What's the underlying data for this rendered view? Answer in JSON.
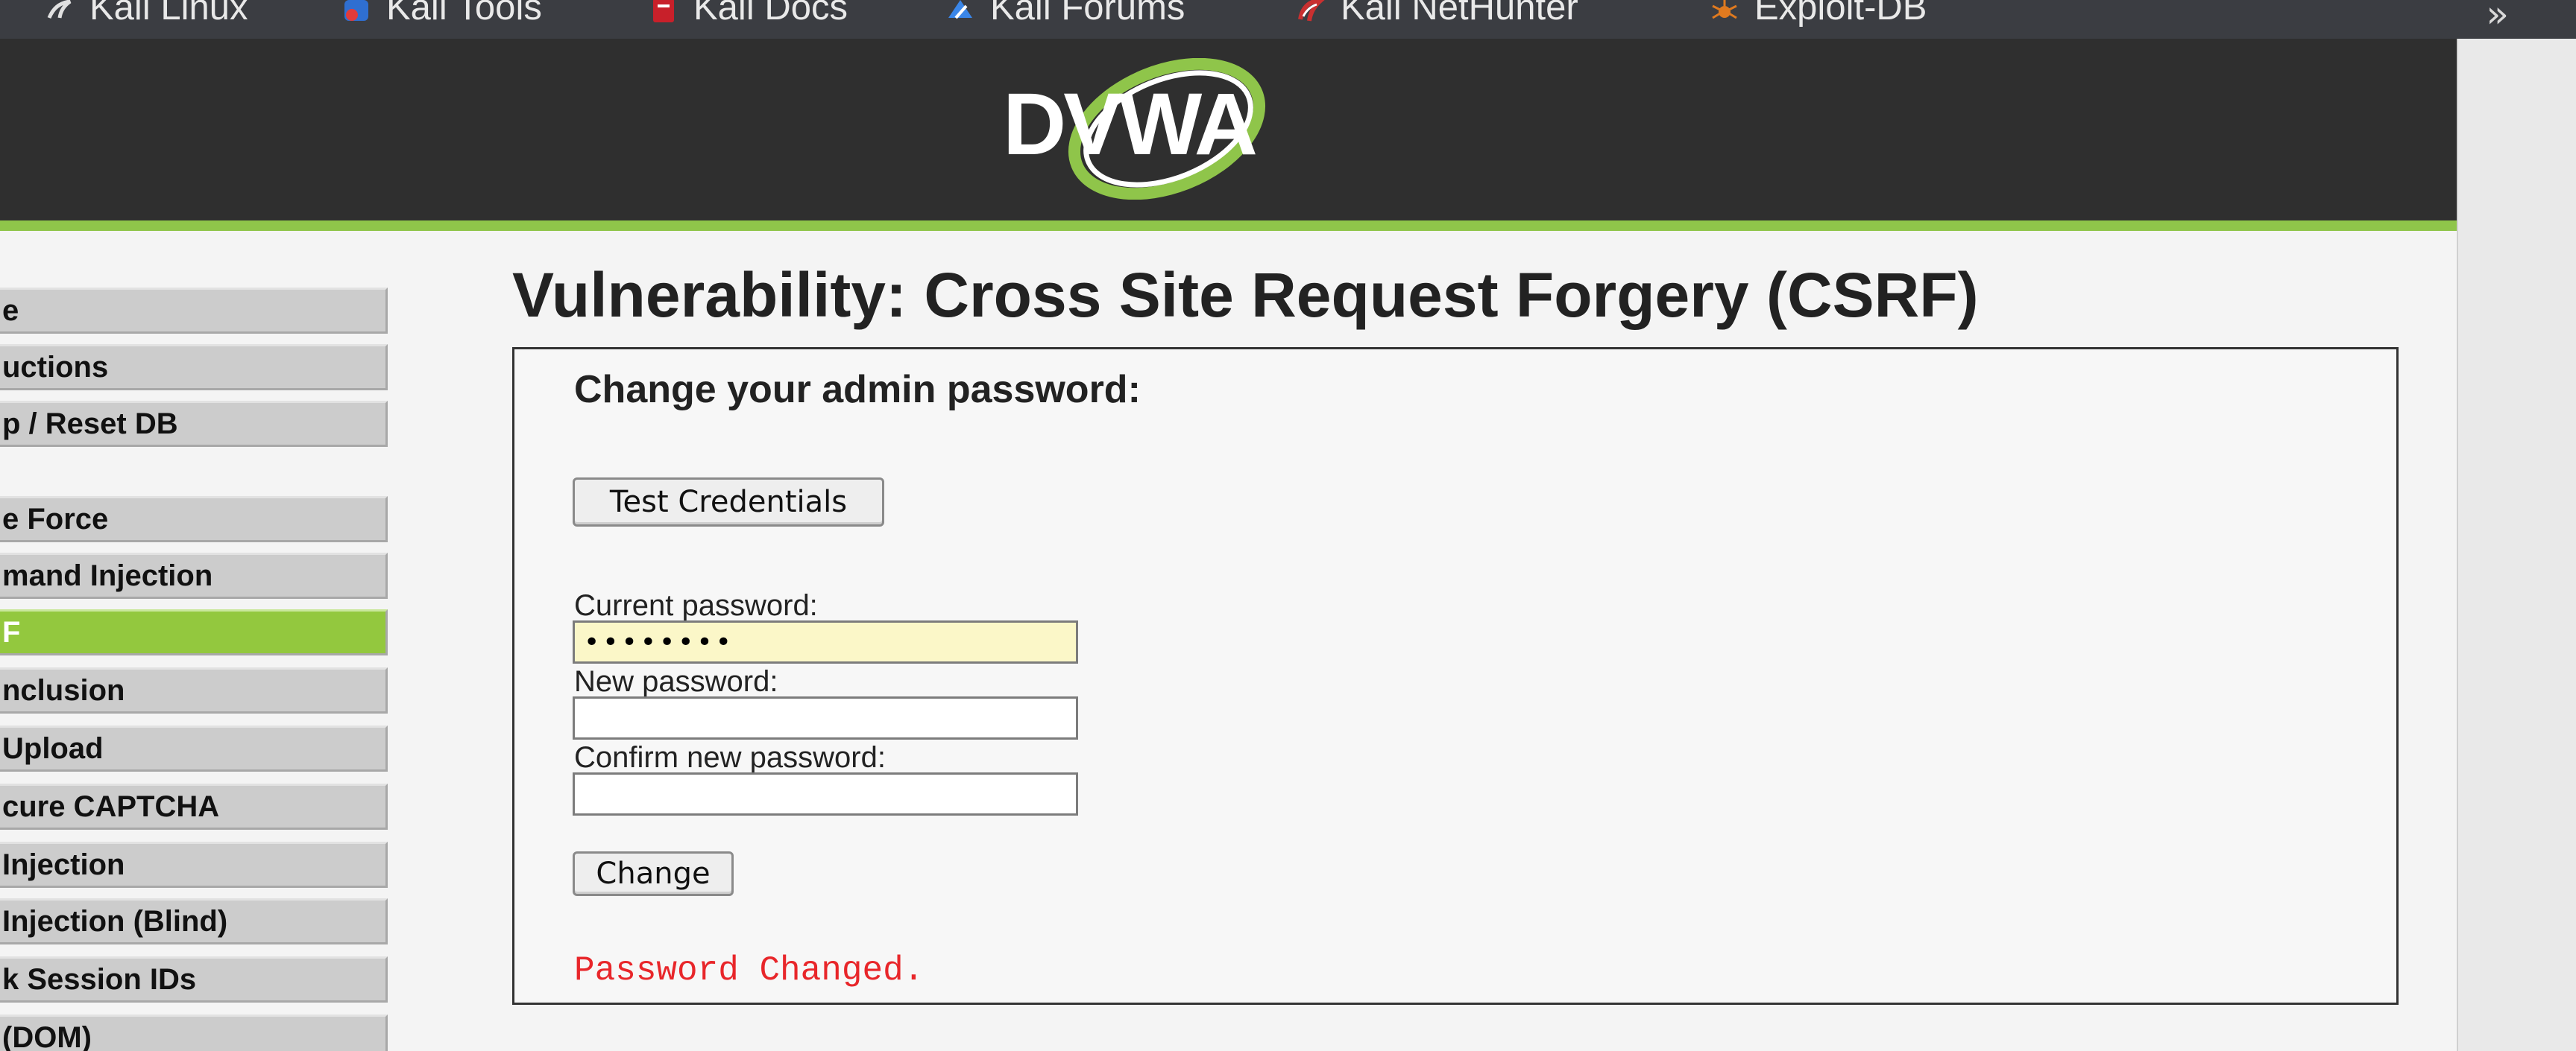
{
  "bookmarks": {
    "items": [
      {
        "label": "Kali Linux",
        "icon": "kali-dragon-icon"
      },
      {
        "label": "Kali Tools",
        "icon": "kali-tools-icon"
      },
      {
        "label": "Kali Docs",
        "icon": "kali-docs-icon"
      },
      {
        "label": "Kali Forums",
        "icon": "kali-forums-icon"
      },
      {
        "label": "Kali NetHunter",
        "icon": "kali-nethunter-icon"
      },
      {
        "label": "Exploit-DB",
        "icon": "exploit-db-icon"
      }
    ],
    "overflow_label": "»"
  },
  "header": {
    "logo_text": "DVWA",
    "accent_color": "#8fc54a"
  },
  "menu": {
    "items": [
      {
        "label": "e",
        "active": false
      },
      {
        "label": "uctions",
        "active": false
      },
      {
        "label": "p / Reset DB",
        "active": false
      },
      {
        "label": "e Force",
        "active": false
      },
      {
        "label": "mand Injection",
        "active": false
      },
      {
        "label": "F",
        "active": true
      },
      {
        "label": "nclusion",
        "active": false
      },
      {
        "label": "Upload",
        "active": false
      },
      {
        "label": "cure CAPTCHA",
        "active": false
      },
      {
        "label": "Injection",
        "active": false
      },
      {
        "label": "Injection (Blind)",
        "active": false
      },
      {
        "label": "k Session IDs",
        "active": false
      },
      {
        "label": "(DOM)",
        "active": false
      }
    ],
    "active_color": "#93c83e"
  },
  "main": {
    "title": "Vulnerability: Cross Site Request Forgery (CSRF)",
    "box_heading": "Change your admin password:",
    "test_credentials_label": "Test Credentials",
    "current_password_label": "Current password:",
    "current_password_value": "••••••••",
    "new_password_label": "New password:",
    "new_password_value": "",
    "confirm_password_label": "Confirm new password:",
    "confirm_password_value": "",
    "change_button_label": "Change",
    "status_message": "Password Changed.",
    "status_color": "#e8262a"
  }
}
